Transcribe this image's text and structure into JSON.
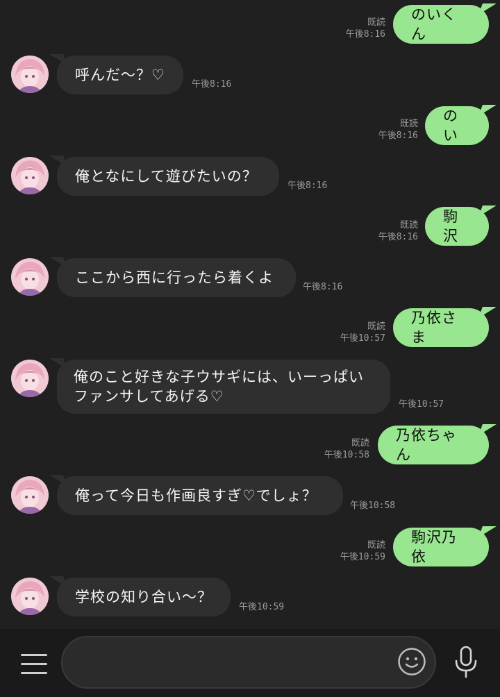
{
  "messages": [
    {
      "id": "m1",
      "side": "out",
      "text": "のいくん",
      "read": "既読",
      "time": "午後8:16"
    },
    {
      "id": "m2",
      "side": "in",
      "text": "呼んだ〜？♡",
      "time": "午後8:16"
    },
    {
      "id": "m3",
      "side": "out",
      "text": "のい",
      "read": "既読",
      "time": "午後8:16"
    },
    {
      "id": "m4",
      "side": "in",
      "text": "俺となにして遊びたいの？",
      "time": "午後8:16"
    },
    {
      "id": "m5",
      "side": "out",
      "text": "駒沢",
      "read": "既読",
      "time": "午後8:16"
    },
    {
      "id": "m6",
      "side": "in",
      "text": "ここから西に行ったら着くよ",
      "time": "午後8:16"
    },
    {
      "id": "m7",
      "side": "out",
      "text": "乃依さま",
      "read": "既読",
      "time": "午後10:57"
    },
    {
      "id": "m8",
      "side": "in",
      "text": "俺のこと好きな子ウサギには、いーっぱいファンサしてあげる♡",
      "time": "午後10:57"
    },
    {
      "id": "m9",
      "side": "out",
      "text": "乃依ちゃん",
      "read": "既読",
      "time": "午後10:58"
    },
    {
      "id": "m10",
      "side": "in",
      "text": "俺って今日も作画良すぎ♡でしょ？",
      "time": "午後10:58"
    },
    {
      "id": "m11",
      "side": "out",
      "text": "駒沢乃依",
      "read": "既読",
      "time": "午後10:59"
    },
    {
      "id": "m12",
      "side": "in",
      "text": "学校の知り合い〜？",
      "time": "午後10:59"
    }
  ],
  "composer": {
    "placeholder": "",
    "icons": {
      "menu": "menu-icon",
      "emoji": "emoji-icon",
      "mic": "microphone-icon"
    }
  },
  "colors": {
    "background": "#202020",
    "outgoing_bubble": "#98e68f",
    "incoming_bubble": "#2f2f2f",
    "meta_text": "#9b9b9b"
  }
}
